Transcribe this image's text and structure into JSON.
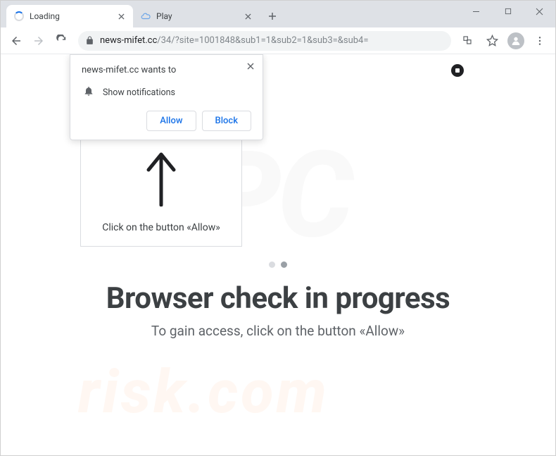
{
  "tabs": [
    {
      "title": "Loading",
      "icon": "spinner"
    },
    {
      "title": "Play",
      "icon": "cloud"
    }
  ],
  "url": {
    "host": "news-mifet.cc",
    "path": "/34/?site=1001848&sub1=1&sub2=1&sub3=&sub4="
  },
  "prompt": {
    "origin": "news-mifet.cc wants to",
    "permission": "Show notifications",
    "allow": "Allow",
    "block": "Block"
  },
  "callout": {
    "text": "Click on the button «Allow»"
  },
  "page": {
    "heading": "Browser check in progress",
    "subheading": "To gain access, click on the button «Allow»"
  },
  "watermark": {
    "pc": "PC",
    "risk": "risk.com"
  }
}
